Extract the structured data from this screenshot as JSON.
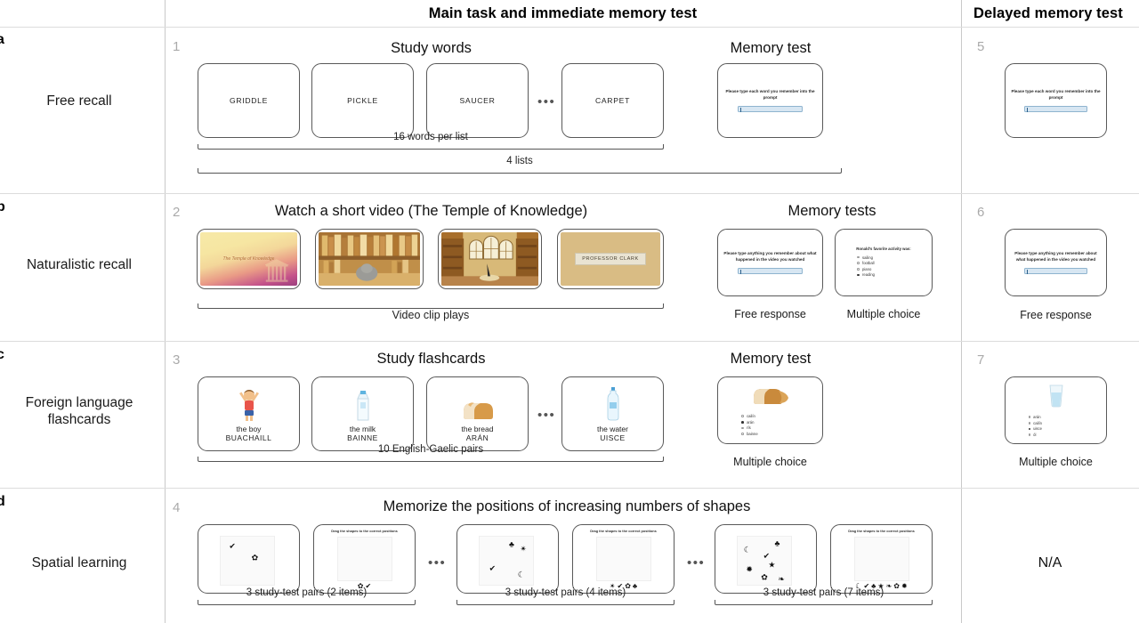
{
  "headers": {
    "main": "Main task and immediate memory test",
    "delayed": "Delayed memory test"
  },
  "rows": [
    {
      "letter": "a",
      "title": "Free recall",
      "step_main": "1",
      "step_delayed": "5",
      "main_title": "Study words",
      "memory_title": "Memory test",
      "word_cards": [
        "GRIDDLE",
        "PICKLE",
        "SAUCER",
        "CARPET"
      ],
      "ellipsis": "•••",
      "bracket_inner": "16 words per list",
      "bracket_outer": "4 lists",
      "prompt": "Please type each word you remember into the prompt",
      "delayed_prompt": "Please type each word you remember into the prompt"
    },
    {
      "letter": "b",
      "title": "Naturalistic recall",
      "step_main": "2",
      "step_delayed": "6",
      "main_title": "Watch a short video (The Temple of Knowledge)",
      "memory_title": "Memory tests",
      "bracket_inner": "Video clip plays",
      "video_title_card": "The Temple of Knowledge",
      "video_professor_card": "PROFESSOR CLARK",
      "free_prompt": "Please type anything you remember about what happened in the video you watched",
      "free_label": "Free response",
      "mc_label": "Multiple choice",
      "mc_question": "Ronald's favorite activity was:",
      "mc_options": [
        "sailing",
        "football",
        "piano",
        "reading"
      ],
      "mc_selected": 3,
      "delayed_prompt": "Please type anything you remember about what happened in the video you watched",
      "delayed_label": "Free response"
    },
    {
      "letter": "c",
      "title": "Foreign language flashcards",
      "step_main": "3",
      "step_delayed": "7",
      "main_title": "Study flashcards",
      "memory_title": "Memory test",
      "flashcards": [
        {
          "english": "the boy",
          "gaelic": "BUACHAILL",
          "icon": "boy-icon"
        },
        {
          "english": "the milk",
          "gaelic": "BAINNE",
          "icon": "milk-carton-icon"
        },
        {
          "english": "the bread",
          "gaelic": "ARÁN",
          "icon": "bread-loaf-icon"
        },
        {
          "english": "the water",
          "gaelic": "UISCE",
          "icon": "water-bottle-icon"
        }
      ],
      "ellipsis": "•••",
      "bracket_inner": "10 English-Gaelic pairs",
      "mc_label": "Multiple choice",
      "mc_options": [
        "cailín",
        "arán",
        "rís",
        "bainne"
      ],
      "mc_selected": 1,
      "mc_image": "bread-loaf-icon",
      "delayed_label": "Multiple choice",
      "delayed_options": [
        "arán",
        "cailín",
        "uisce",
        "ól"
      ],
      "delayed_selected": 2,
      "delayed_image": "water-glass-icon"
    },
    {
      "letter": "d",
      "title": "Spatial learning",
      "step_main": "4",
      "main_title": "Memorize the positions of increasing numbers of shapes",
      "ellipsis": "•••",
      "drag_prompt": "Drag the shapes to the correct positions",
      "brackets": [
        "3 study-test pairs (2 items)",
        "3 study-test pairs (4 items)",
        "3 study-test pairs (7 items)"
      ],
      "delayed_value": "N/A",
      "study_sets": [
        {
          "shapes": [
            "✔",
            "✿"
          ]
        },
        {
          "shapes": [
            "♣",
            "✴",
            "✔",
            "☾"
          ]
        },
        {
          "shapes": [
            "☾",
            "♣",
            "✔",
            "★",
            "✹",
            "✿",
            "❧"
          ]
        }
      ],
      "tray_sets": [
        [
          "✿",
          "✔"
        ],
        [
          "✴",
          "✔",
          "✿",
          "♣"
        ],
        [
          "☾",
          "✔",
          "♣",
          "★",
          "❧",
          "✿",
          "✹"
        ]
      ]
    }
  ]
}
